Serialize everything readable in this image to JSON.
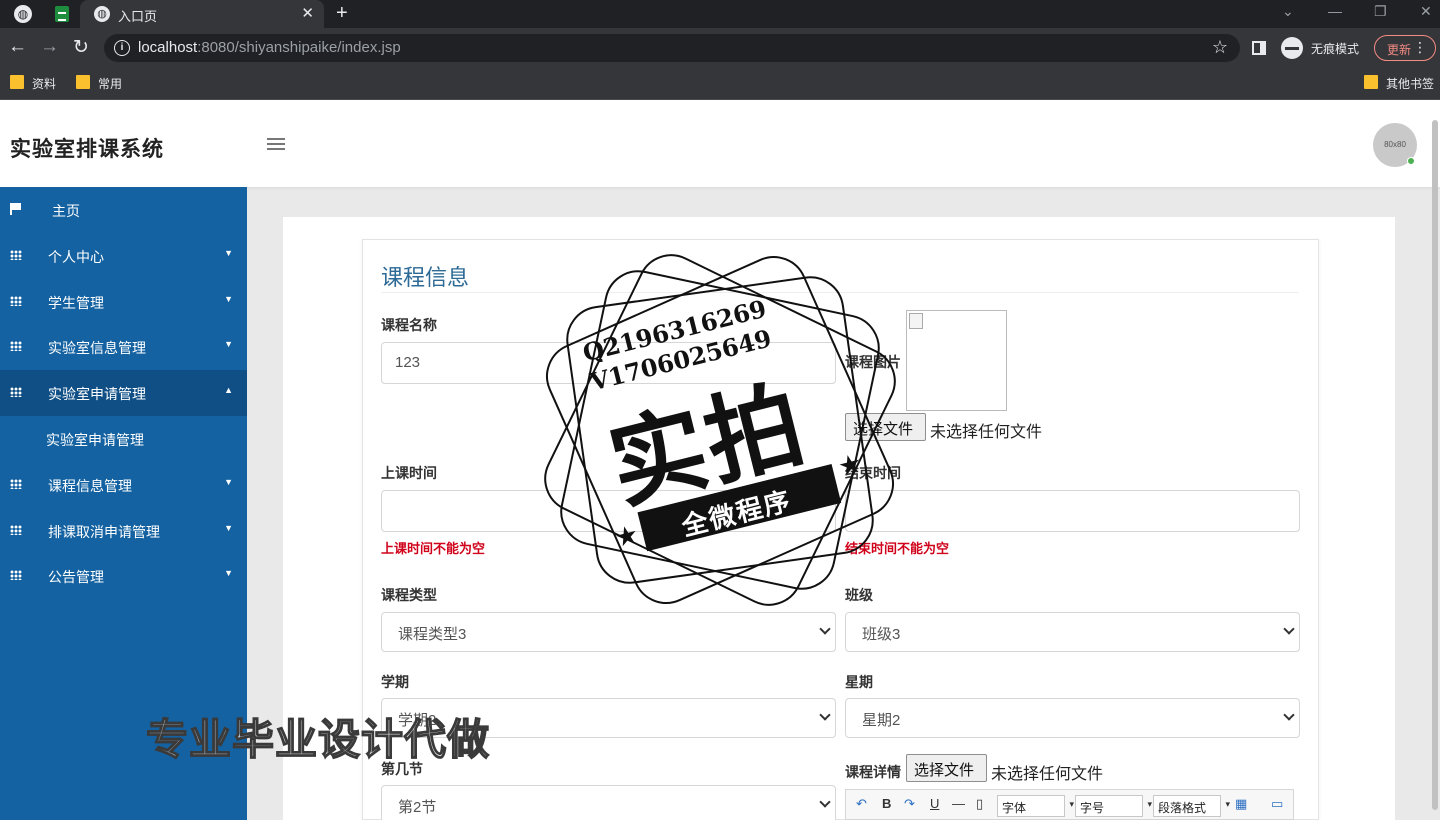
{
  "browser": {
    "tab_title": "入口页",
    "url_host": "localhost",
    "url_rest": ":8080/shiyanshipaike/index.jsp",
    "incognito_label": "无痕模式",
    "update_label": "更新",
    "bookmarks": [
      "资料",
      "常用"
    ],
    "other_bookmarks": "其他书签"
  },
  "app": {
    "brand": "实验室排课系统",
    "avatar_text": "80x80"
  },
  "sidebar": {
    "items": [
      {
        "label": "主页"
      },
      {
        "label": "个人中心"
      },
      {
        "label": "学生管理"
      },
      {
        "label": "实验室信息管理"
      },
      {
        "label": "实验室申请管理"
      },
      {
        "label": "实验室申请管理"
      },
      {
        "label": "课程信息管理"
      },
      {
        "label": "排课取消申请管理"
      },
      {
        "label": "公告管理"
      }
    ]
  },
  "form": {
    "title": "课程信息",
    "course_name_label": "课程名称",
    "course_name_value": "123",
    "course_image_label": "课程图片",
    "choose_file": "选择文件",
    "no_file": "未选择任何文件",
    "start_time_label": "上课时间",
    "start_time_error": "上课时间不能为空",
    "end_time_label": "结束时间",
    "end_time_error": "结束时间不能为空",
    "course_type_label": "课程类型",
    "course_type_value": "课程类型3",
    "class_label": "班级",
    "class_value": "班级3",
    "term_label": "学期",
    "term_value": "学期2",
    "weekday_label": "星期",
    "weekday_value": "星期2",
    "section_label": "第几节",
    "section_value": "第2节",
    "detail_label": "课程详情",
    "editor": {
      "font": "字体",
      "size": "字号",
      "paragraph": "段落格式",
      "bold": "B",
      "underline": "U"
    }
  },
  "watermark": {
    "qq": "Q2196316269",
    "vx": "V1706025649",
    "big": "实拍",
    "ribbon": "全微程序",
    "overlay": "专业毕业设计代做"
  },
  "colors": {
    "sidebar": "#1462a2",
    "title": "#2d6a96",
    "error": "#d0021b"
  }
}
